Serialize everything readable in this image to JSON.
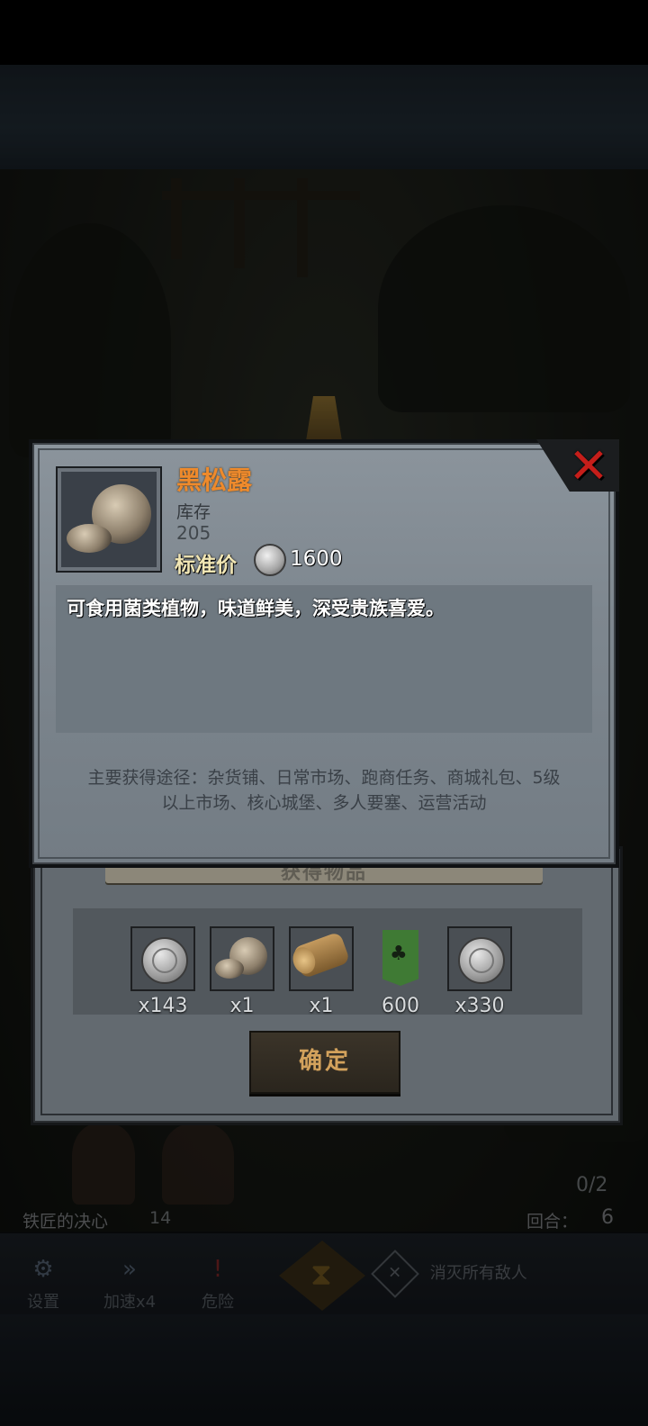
{
  "item": {
    "name": "黑松露",
    "stock_label": "库存",
    "stock_value": "205",
    "price_label": "标准价",
    "price_value": "1600",
    "description": "可食用菌类植物，味道鲜美，深受贵族喜爱。",
    "source_line1": "主要获得途径：杂货铺、日常市场、跑商任务、商城礼包、5级",
    "source_line2": "以上市场、核心城堡、多人要塞、运营活动",
    "close_glyph": "✕"
  },
  "reward_dialog": {
    "title": "获得物品",
    "confirm_label": "确定",
    "rewards": [
      {
        "icon": "silver-coin-icon",
        "count": "x143"
      },
      {
        "icon": "truffle-icon",
        "count": "x1"
      },
      {
        "icon": "wood-log-icon",
        "count": "x1"
      },
      {
        "icon": "tree-banner-icon",
        "count": "600"
      },
      {
        "icon": "silver-coin-icon",
        "count": "x330"
      }
    ]
  },
  "battle": {
    "skill_name": "铁匠的决心",
    "skill_number": "14",
    "round_label": "回合：",
    "round_value": "6",
    "counter": "0/2"
  },
  "bottom_bar": {
    "settings": "设置",
    "speed": "加速x4",
    "danger": "危险",
    "objective": "消灭所有敌人"
  },
  "colors": {
    "item_name": "#ee8a2c",
    "close": "#c51e1a",
    "confirm_text": "#d3a25c",
    "tree_banner": "#3f7a34"
  }
}
